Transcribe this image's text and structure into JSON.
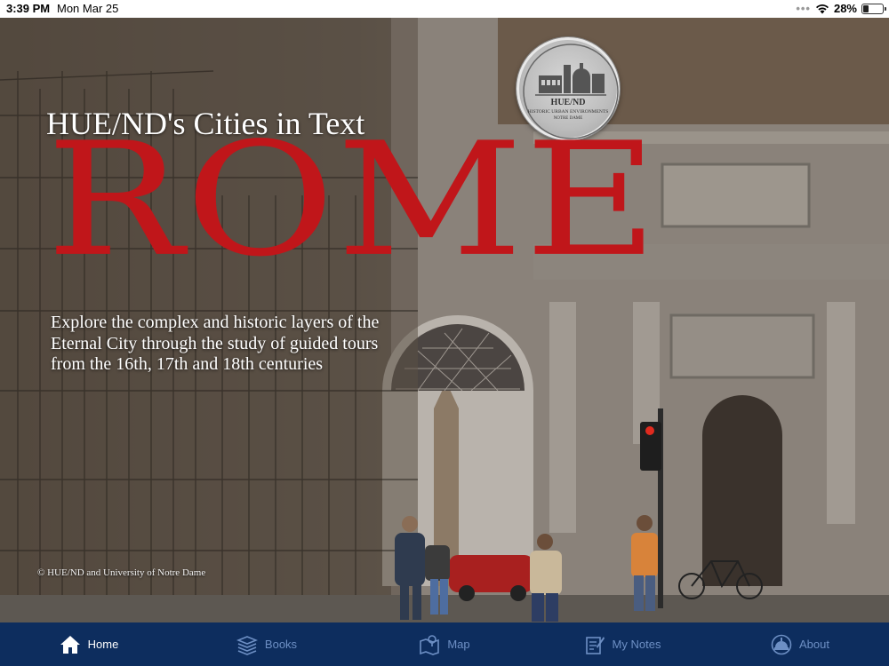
{
  "status": {
    "time": "3:39 PM",
    "date": "Mon Mar 25",
    "battery_percent": "28%",
    "battery_level": 0.28
  },
  "hero": {
    "subtitle": "HUE/ND's Cities in Text",
    "title": "ROME",
    "description": "Explore the complex and historic layers of the Eternal City through the study of guided tours from the 16th, 17th and 18th centuries",
    "copyright": "© HUE/ND and University of Notre Dame",
    "title_color": "#c0161a"
  },
  "seal": {
    "name": "HUE/ND",
    "line1": "HISTORIC URBAN ENVIRONMENTS",
    "line2": "NOTRE DAME"
  },
  "tabs": [
    {
      "label": "Home",
      "icon": "house-icon",
      "active": true
    },
    {
      "label": "Books",
      "icon": "books-icon",
      "active": false
    },
    {
      "label": "Map",
      "icon": "map-icon",
      "active": false
    },
    {
      "label": "My Notes",
      "icon": "notes-icon",
      "active": false
    },
    {
      "label": "About",
      "icon": "dome-icon",
      "active": false
    }
  ],
  "colors": {
    "tabbar_bg": "#0d2d5e",
    "tab_active": "#ffffff",
    "tab_inactive": "#6d8fc4"
  }
}
